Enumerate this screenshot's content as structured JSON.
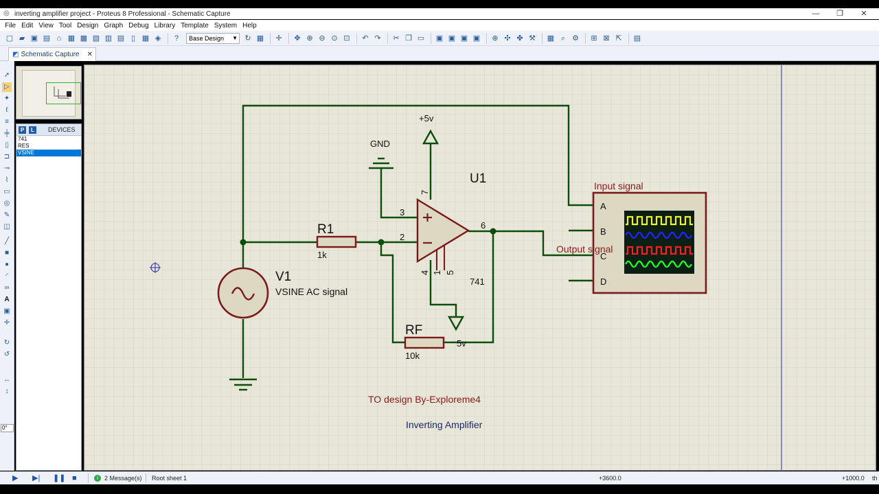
{
  "window": {
    "title": "inverting amplifier project - Proteus 8 Professional - Schematic Capture",
    "icon": "proteus-app-icon",
    "minimize": "—",
    "restore": "❐",
    "close": "✕"
  },
  "menu": [
    "File",
    "Edit",
    "View",
    "Tool",
    "Design",
    "Graph",
    "Debug",
    "Library",
    "Template",
    "System",
    "Help"
  ],
  "toolbar": {
    "design_select": "Base Design"
  },
  "tab": {
    "label": "Schematic Capture",
    "close": "✕"
  },
  "devices": {
    "p_button": "P",
    "l_button": "L",
    "header": "DEVICES",
    "items": [
      "741",
      "RES",
      "VSINE"
    ],
    "selected_index": 2
  },
  "left_tools": {
    "angle_value": "0°"
  },
  "schematic": {
    "power_label": "+5v",
    "gnd_label": "GND",
    "opamp_ref": "U1",
    "opamp_value": "741",
    "pin_3": "3",
    "pin_2": "2",
    "pin_6": "6",
    "pin_7": "7",
    "pin_4": "4",
    "pin_1": "1",
    "pin_5": "5",
    "r1_ref": "R1",
    "r1_value": "1k",
    "rf_ref": "RF",
    "rf_value": "10k",
    "rf_net_label": "5v",
    "v1_ref": "V1",
    "v1_value": "VSINE AC signal",
    "scope_input_label": "Input signal",
    "scope_output_label": "Output signal",
    "scope_channels": [
      "A",
      "B",
      "C",
      "D"
    ],
    "credit_text": "TO design By-Exploreme4",
    "circuit_title": "Inverting Amplifier",
    "colors": {
      "wire": "#0b4d0b",
      "component": "#7a1a1a",
      "credit": "#8b1a1a",
      "title": "#1a2b66",
      "grid_bg": "#e8e6d8"
    }
  },
  "status": {
    "messages": "2 Message(s)",
    "sheet": "Root sheet 1",
    "coord_x": "+3600.0",
    "coord_y": "+1000.0",
    "units": "th"
  }
}
